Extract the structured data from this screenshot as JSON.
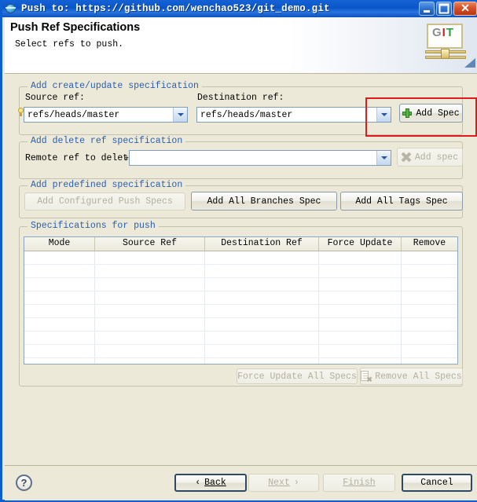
{
  "window": {
    "title": "Push to: https://github.com/wenchao523/git_demo.git",
    "app_icon": "globe-icon",
    "controls": {
      "minimize": "_",
      "maximize": "□",
      "close": "✕"
    }
  },
  "header": {
    "title": "Push Ref Specifications",
    "subtitle": "Select refs to push.",
    "logo": {
      "g": "G",
      "i": "I",
      "t": "T"
    }
  },
  "create_update_group": {
    "legend": "Add create/update specification",
    "source_label": "Source ref:",
    "source_value": "refs/heads/master",
    "destination_label": "Destination ref:",
    "destination_value": "refs/heads/master",
    "add_spec_button": "Add Spec"
  },
  "delete_group": {
    "legend": "Add delete ref specification",
    "remote_label": "Remote ref to delete:",
    "remote_value": "",
    "remote_marker": "*",
    "add_spec_button": "Add spec"
  },
  "predefined_group": {
    "legend": "Add predefined specification",
    "add_configured": "Add Configured Push Specs",
    "add_all_branches": "Add All Branches Spec",
    "add_all_tags": "Add All Tags Spec"
  },
  "specifications_group": {
    "legend": "Specifications for push",
    "columns": [
      "Mode",
      "Source Ref",
      "Destination Ref",
      "Force Update",
      "Remove"
    ],
    "rows": [],
    "empty_row_count": 12,
    "force_update_all": "Force Update All Specs",
    "remove_all": "Remove All Specs"
  },
  "footer": {
    "help": "?",
    "back": "Back",
    "back_prefix": "‹",
    "next": "Next",
    "next_suffix": "›",
    "finish": "Finish",
    "cancel": "Cancel"
  },
  "colors": {
    "title_bar": "#0a56c8",
    "dialog_bg": "#ece9d8",
    "group_legend": "#2a5db0",
    "highlight": "#e11b1b",
    "field_border": "#7f9db9"
  }
}
